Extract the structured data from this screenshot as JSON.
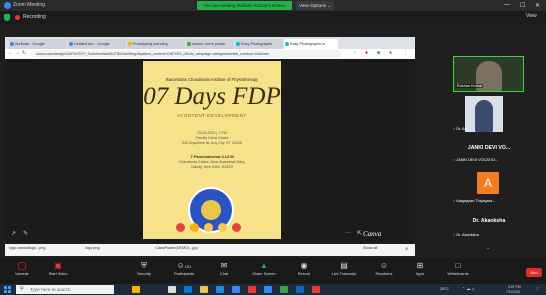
{
  "zoom": {
    "window_title": "Zoom Meeting",
    "share_banner": "You are viewing Roshan Kumar's screen",
    "view_options": "View Options ⌄",
    "recording_label": "Recording",
    "view_button": "View",
    "win_min": "—",
    "win_max": "☐",
    "win_close": "✕"
  },
  "browser": {
    "tabs": [
      {
        "label": "Scribrati - Google"
      },
      {
        "label": "Untitled doc - Google"
      },
      {
        "label": "Prototyping planning"
      },
      {
        "label": "search event poster"
      },
      {
        "label": "Easy Photographs"
      },
      {
        "label": "Easy Photographs in"
      }
    ],
    "url": "canva.com/design/DAFXKSOY_Sxk/view#wkMbJ7BkXwkXbbg/dipattern_content=DAFXKS_IJBnfo_campaign=designsharelink_medium=link&utm",
    "download_items": [
      "logo-rasmidlogo...png",
      "logo.png",
      "ClassPoster(DEMO)...jpg"
    ],
    "show_all": "Show all",
    "canva_brand": "Canva"
  },
  "poster": {
    "institute": "Banarsidas Chandiwala Institute of Physiotherapy",
    "title": "07 Days FDP",
    "subtitle": "eCONTENT DEVELOPMENT",
    "date_line": "25.03.2021 | 7 PM",
    "venue_line_1": "Faculty Great Chairs",
    "venue_line_2": "BDI Anywhere At, Any City, ST 12345",
    "trainer_line": "7 Parachatronia 4.14 M",
    "address_line_1": "Chandiwala Estate, Near Anandmai Marg,",
    "address_line_2": "Kalkaji, New Delhi 110019"
  },
  "participants": {
    "tile_1_name": "Roshan Kumar",
    "tile_2_name": "Dr. Ani",
    "tile_3_title": "JANKI DEVI VO...",
    "tile_3_sub": "JANKI DEVI VOCATIO...",
    "tile_4_letter": "A",
    "tile_4_name": "Alagappan Thiyagara...",
    "tile_5_title": "Dr. Akanksha",
    "tile_5_sub": "Dr. Akanksha"
  },
  "toolbar": {
    "unmute": "Unmute",
    "start_video": "Start Video",
    "security": "Security",
    "participants": "Participants",
    "participants_count": "101",
    "chat": "Chat",
    "share_screen": "Share Screen",
    "record": "Record",
    "live_transcript": "Live Transcript",
    "reactions": "Reactions",
    "apps": "Apps",
    "whiteboards": "Whiteboards",
    "end": "End"
  },
  "taskbar": {
    "search_placeholder": "Type here to search",
    "temperature": "28°C",
    "time": "3:07 PM",
    "date": "7/21/2023"
  },
  "colors": {
    "zoom_green": "#22b14c",
    "poster_bg": "#f6e289",
    "end_red": "#e02d2d"
  }
}
